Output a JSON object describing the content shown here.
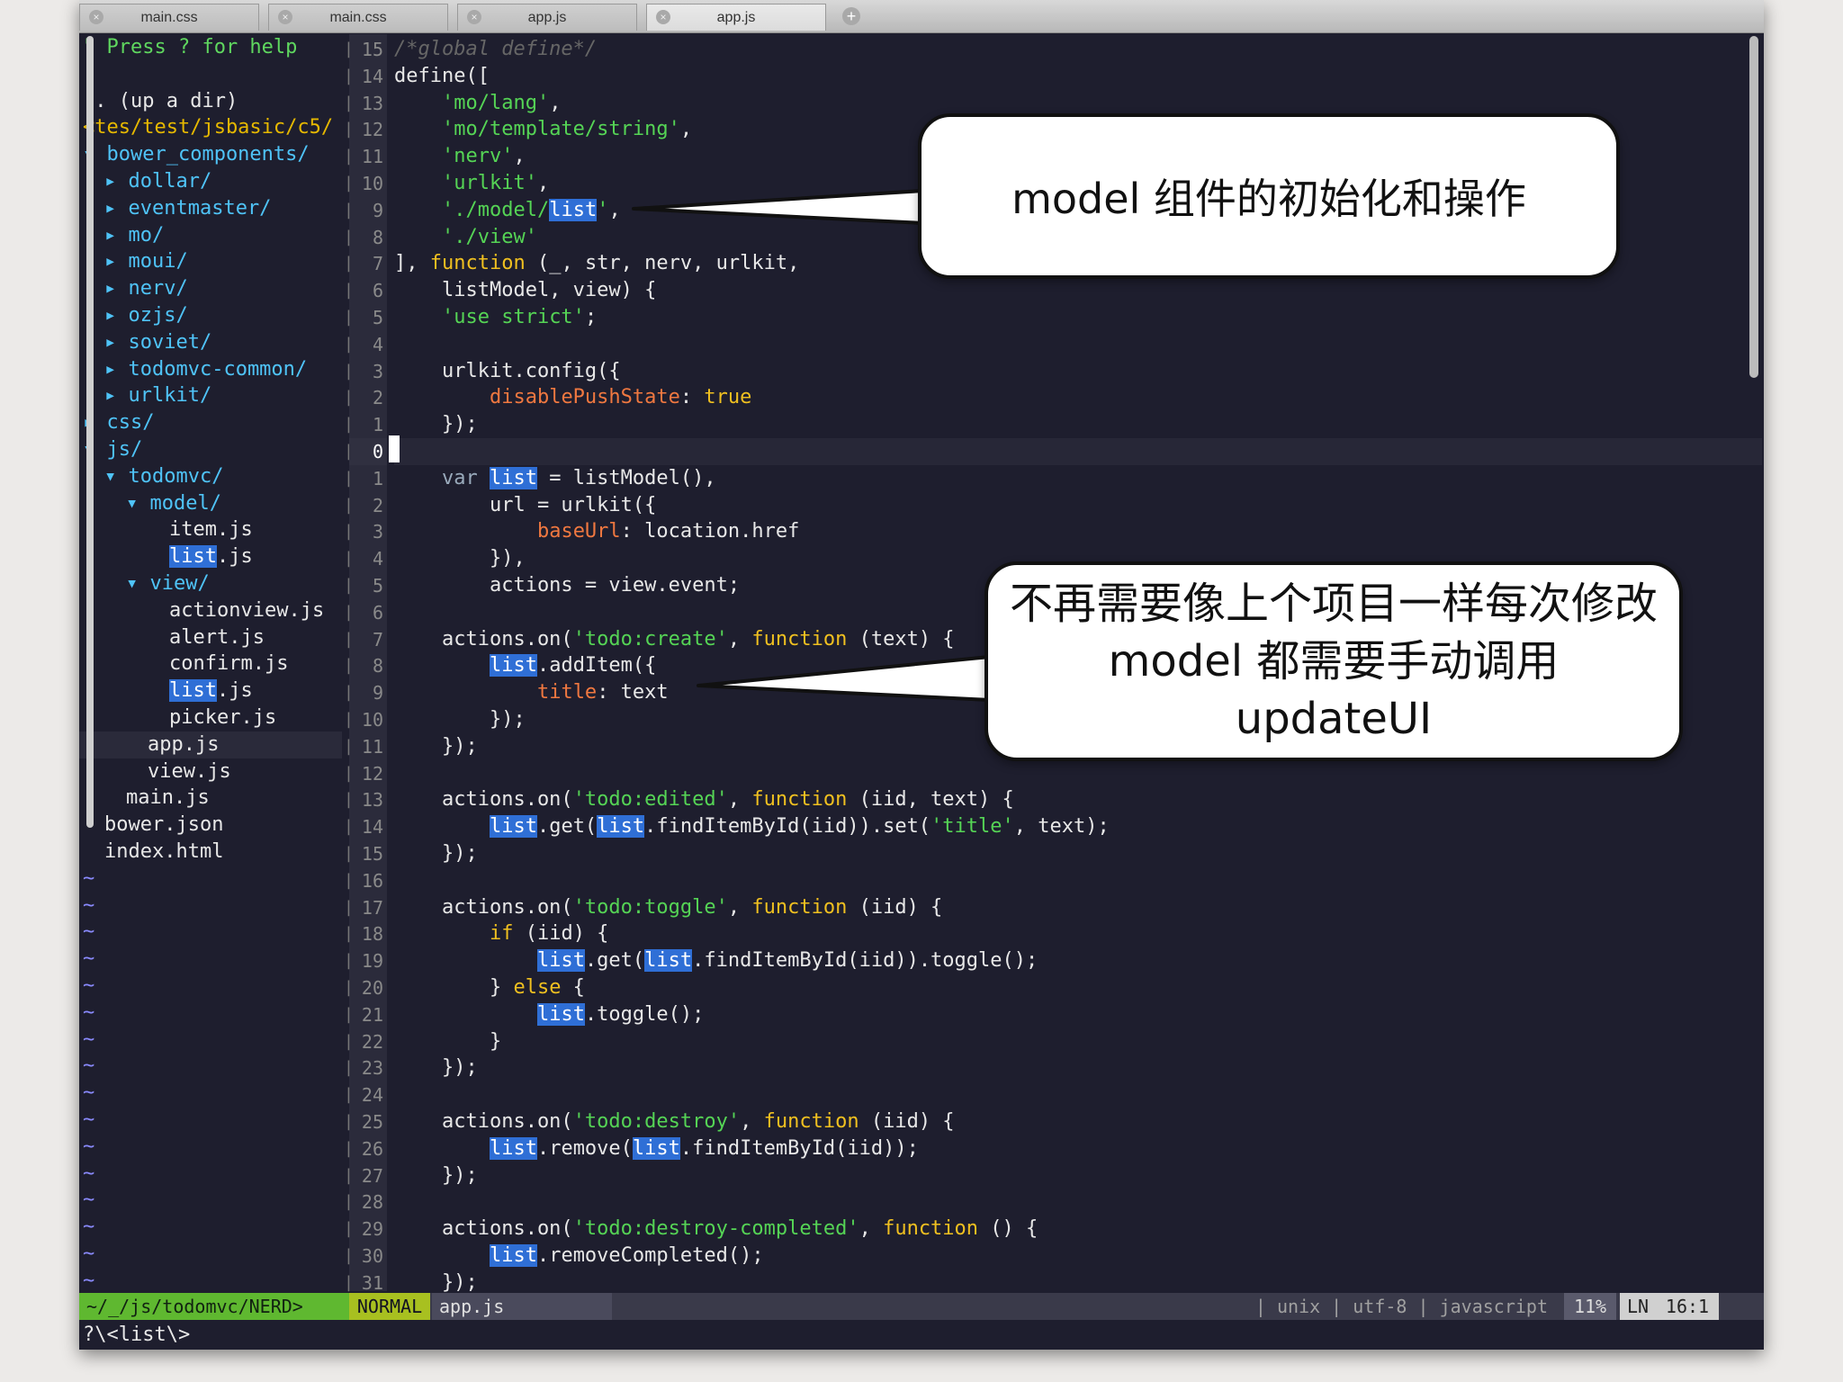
{
  "tabs": [
    {
      "label": "main.css",
      "close": "×"
    },
    {
      "label": "main.css",
      "close": "×"
    },
    {
      "label": "app.js",
      "close": "×"
    },
    {
      "label": "app.js",
      "close": "×",
      "active": true
    }
  ],
  "new_tab_icon": "+",
  "tree": {
    "help": "\" Press ? for help",
    "up": ".. (up a dir)",
    "path": "<tes/test/jsbasic/c5/",
    "items": [
      {
        "text": "▾ bower_components/",
        "indent": 0,
        "kind": "dir"
      },
      {
        "text": "▸ dollar/",
        "indent": 1,
        "kind": "dir"
      },
      {
        "text": "▸ eventmaster/",
        "indent": 1,
        "kind": "dir"
      },
      {
        "text": "▸ mo/",
        "indent": 1,
        "kind": "dir"
      },
      {
        "text": "▸ moui/",
        "indent": 1,
        "kind": "dir"
      },
      {
        "text": "▸ nerv/",
        "indent": 1,
        "kind": "dir"
      },
      {
        "text": "▸ ozjs/",
        "indent": 1,
        "kind": "dir"
      },
      {
        "text": "▸ soviet/",
        "indent": 1,
        "kind": "dir"
      },
      {
        "text": "▸ todomvc-common/",
        "indent": 1,
        "kind": "dir"
      },
      {
        "text": "▸ urlkit/",
        "indent": 1,
        "kind": "dir"
      },
      {
        "text": "▸ css/",
        "indent": 0,
        "kind": "dir"
      },
      {
        "text": "▾ js/",
        "indent": 0,
        "kind": "dir"
      },
      {
        "text": "▾ todomvc/",
        "indent": 1,
        "kind": "dir"
      },
      {
        "text": "▾ model/",
        "indent": 2,
        "kind": "dir"
      },
      {
        "text": "item.js",
        "indent": 4,
        "kind": "file"
      },
      {
        "text": "list.js",
        "indent": 4,
        "kind": "file",
        "hl": "list"
      },
      {
        "text": "▾ view/",
        "indent": 2,
        "kind": "dir"
      },
      {
        "text": "actionview.js",
        "indent": 4,
        "kind": "file"
      },
      {
        "text": "alert.js",
        "indent": 4,
        "kind": "file"
      },
      {
        "text": "confirm.js",
        "indent": 4,
        "kind": "file"
      },
      {
        "text": "list.js",
        "indent": 4,
        "kind": "file",
        "hl": "list"
      },
      {
        "text": "picker.js",
        "indent": 4,
        "kind": "file"
      },
      {
        "text": "app.js",
        "indent": 3,
        "kind": "file",
        "current": true
      },
      {
        "text": "view.js",
        "indent": 3,
        "kind": "file"
      },
      {
        "text": "main.js",
        "indent": 2,
        "kind": "file"
      },
      {
        "text": "bower.json",
        "indent": 1,
        "kind": "file"
      },
      {
        "text": "index.html",
        "indent": 1,
        "kind": "file"
      }
    ],
    "tilde": "~",
    "tilde_count": 16
  },
  "gutter": [
    "15",
    "14",
    "13",
    "12",
    "11",
    "10",
    "9",
    "8",
    "7",
    "6",
    "5",
    "4",
    "3",
    "2",
    "1",
    "0",
    "1",
    "2",
    "3",
    "4",
    "5",
    "6",
    "7",
    "8",
    "9",
    "10",
    "11",
    "12",
    "13",
    "14",
    "15",
    "16",
    "17",
    "18",
    "19",
    "20",
    "21",
    "22",
    "23",
    "24",
    "25",
    "26",
    "27",
    "28",
    "29",
    "30",
    "31"
  ],
  "current_line_index": 15,
  "code": [
    [
      [
        "cmt",
        "/*global define*/"
      ]
    ],
    [
      [
        "",
        "define(["
      ]
    ],
    [
      [
        "",
        "    "
      ],
      [
        "str",
        "'mo/lang'"
      ],
      [
        "",
        ","
      ]
    ],
    [
      [
        "",
        "    "
      ],
      [
        "str",
        "'mo/template/string'"
      ],
      [
        "",
        ","
      ]
    ],
    [
      [
        "",
        "    "
      ],
      [
        "str",
        "'nerv'"
      ],
      [
        "",
        ","
      ]
    ],
    [
      [
        "",
        "    "
      ],
      [
        "str",
        "'urlkit'"
      ],
      [
        "",
        ","
      ]
    ],
    [
      [
        "",
        "    "
      ],
      [
        "str",
        "'./model/"
      ],
      [
        "hl",
        "list"
      ],
      [
        "str",
        "'"
      ],
      [
        "",
        ","
      ]
    ],
    [
      [
        "",
        "    "
      ],
      [
        "str",
        "'./view'"
      ]
    ],
    [
      [
        "",
        "], "
      ],
      [
        "kw",
        "function"
      ],
      [
        "",
        " (_, str, nerv, urlkit,"
      ]
    ],
    [
      [
        "",
        "    listModel, view) {"
      ]
    ],
    [
      [
        "",
        "    "
      ],
      [
        "str",
        "'use strict'"
      ],
      [
        "",
        ";"
      ]
    ],
    [
      [
        "",
        ""
      ]
    ],
    [
      [
        "",
        "    urlkit.config({"
      ]
    ],
    [
      [
        "",
        "        "
      ],
      [
        "prop",
        "disablePushState"
      ],
      [
        "",
        ": "
      ],
      [
        "kw",
        "true"
      ]
    ],
    [
      [
        "",
        "    });"
      ]
    ],
    [
      [
        "",
        ""
      ]
    ],
    [
      [
        "",
        "    "
      ],
      [
        "dim",
        "var "
      ],
      [
        "hl",
        "list"
      ],
      [
        "",
        " = listModel(),"
      ]
    ],
    [
      [
        "",
        "        url = urlkit({"
      ]
    ],
    [
      [
        "",
        "            "
      ],
      [
        "prop",
        "baseUrl"
      ],
      [
        "",
        ": location.href"
      ]
    ],
    [
      [
        "",
        "        }),"
      ]
    ],
    [
      [
        "",
        "        actions = view.event;"
      ]
    ],
    [
      [
        "",
        ""
      ]
    ],
    [
      [
        "",
        "    actions.on("
      ],
      [
        "str",
        "'todo:create'"
      ],
      [
        "",
        ", "
      ],
      [
        "kw",
        "function"
      ],
      [
        "",
        " (text) {"
      ]
    ],
    [
      [
        "",
        "        "
      ],
      [
        "hl",
        "list"
      ],
      [
        "",
        ".addItem({"
      ]
    ],
    [
      [
        "",
        "            "
      ],
      [
        "prop",
        "title"
      ],
      [
        "",
        ": text"
      ]
    ],
    [
      [
        "",
        "        });"
      ]
    ],
    [
      [
        "",
        "    });"
      ]
    ],
    [
      [
        "",
        ""
      ]
    ],
    [
      [
        "",
        "    actions.on("
      ],
      [
        "str",
        "'todo:edited'"
      ],
      [
        "",
        ", "
      ],
      [
        "kw",
        "function"
      ],
      [
        "",
        " (iid, text) {"
      ]
    ],
    [
      [
        "",
        "        "
      ],
      [
        "hl",
        "list"
      ],
      [
        "",
        ".get("
      ],
      [
        "hl",
        "list"
      ],
      [
        "",
        ".findItemById(iid)).set("
      ],
      [
        "str",
        "'title'"
      ],
      [
        "",
        ", text);"
      ]
    ],
    [
      [
        "",
        "    });"
      ]
    ],
    [
      [
        "",
        ""
      ]
    ],
    [
      [
        "",
        "    actions.on("
      ],
      [
        "str",
        "'todo:toggle'"
      ],
      [
        "",
        ", "
      ],
      [
        "kw",
        "function"
      ],
      [
        "",
        " (iid) {"
      ]
    ],
    [
      [
        "",
        "        "
      ],
      [
        "kw",
        "if"
      ],
      [
        "",
        " (iid) {"
      ]
    ],
    [
      [
        "",
        "            "
      ],
      [
        "hl",
        "list"
      ],
      [
        "",
        ".get("
      ],
      [
        "hl",
        "list"
      ],
      [
        "",
        ".findItemById(iid)).toggle();"
      ]
    ],
    [
      [
        "",
        "        } "
      ],
      [
        "kw",
        "else"
      ],
      [
        "",
        " {"
      ]
    ],
    [
      [
        "",
        "            "
      ],
      [
        "hl",
        "list"
      ],
      [
        "",
        ".toggle();"
      ]
    ],
    [
      [
        "",
        "        }"
      ]
    ],
    [
      [
        "",
        "    });"
      ]
    ],
    [
      [
        "",
        ""
      ]
    ],
    [
      [
        "",
        "    actions.on("
      ],
      [
        "str",
        "'todo:destroy'"
      ],
      [
        "",
        ", "
      ],
      [
        "kw",
        "function"
      ],
      [
        "",
        " (iid) {"
      ]
    ],
    [
      [
        "",
        "        "
      ],
      [
        "hl",
        "list"
      ],
      [
        "",
        ".remove("
      ],
      [
        "hl",
        "list"
      ],
      [
        "",
        ".findItemById(iid));"
      ]
    ],
    [
      [
        "",
        "    });"
      ]
    ],
    [
      [
        "",
        ""
      ]
    ],
    [
      [
        "",
        "    actions.on("
      ],
      [
        "str",
        "'todo:destroy-completed'"
      ],
      [
        "",
        ", "
      ],
      [
        "kw",
        "function"
      ],
      [
        "",
        " () {"
      ]
    ],
    [
      [
        "",
        "        "
      ],
      [
        "hl",
        "list"
      ],
      [
        "",
        ".removeCompleted();"
      ]
    ],
    [
      [
        "",
        "    });"
      ]
    ]
  ],
  "status": {
    "nerd": "~/_/js/todomvc/NERD>",
    "mode": "NORMAL",
    "file": "app.js",
    "right": "| unix | utf-8 | javascript",
    "percent": "11%",
    "ln_label": "LN",
    "position": "16:1"
  },
  "cmdline": "?\\<list\\>",
  "callouts": {
    "top": "model 组件的初始化和操作",
    "bottom": "不再需要像上个项目一样每次修改 model 都需要手动调用 updateUI"
  },
  "colors": {
    "background": "#1e1e2e",
    "string": "#55d455",
    "keyword": "#f0c020",
    "property": "#f07840",
    "highlight": "#2f6fd6"
  }
}
